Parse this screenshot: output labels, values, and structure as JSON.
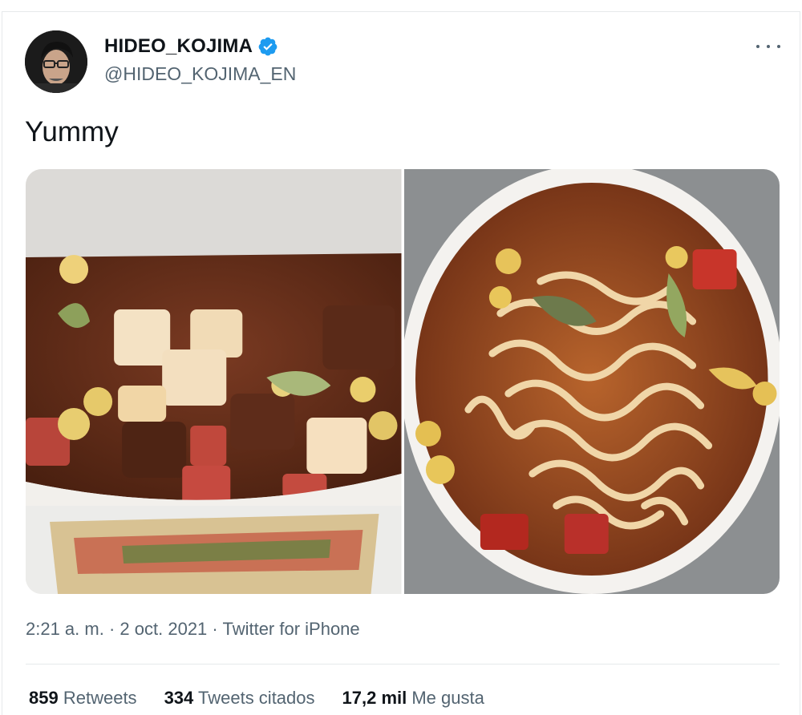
{
  "user": {
    "display_name": "HIDEO_KOJIMA",
    "handle": "@HIDEO_KOJIMA_EN",
    "verified": true
  },
  "tweet": {
    "text": "Yummy",
    "time": "2:21 a. m.",
    "date": "2 oct. 2021",
    "separator": "·",
    "source": "Twitter for iPhone"
  },
  "media": {
    "photos": [
      {
        "name": "photo-ramen-cup-dry"
      },
      {
        "name": "photo-ramen-cup-cooked"
      }
    ]
  },
  "stats": {
    "retweets_count": "859",
    "retweets_label": "Retweets",
    "quotes_count": "334",
    "quotes_label": "Tweets citados",
    "likes_count": "17,2 mil",
    "likes_label": "Me gusta"
  },
  "colors": {
    "verified_badge": "#1d9bf0",
    "secondary_text": "#536471",
    "primary_text": "#0f1419"
  },
  "icons": [
    "verified-badge-icon",
    "more-options-icon"
  ]
}
